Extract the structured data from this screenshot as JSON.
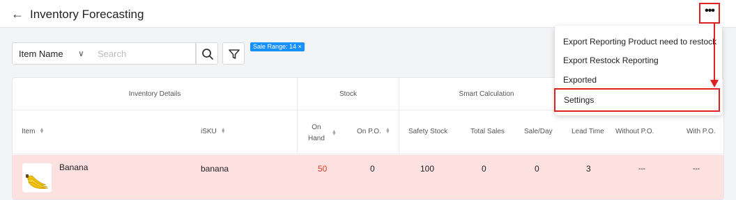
{
  "header": {
    "title": "Inventory Forecasting",
    "back_icon": "arrow-left-icon",
    "more_icon": "ellipsis-icon"
  },
  "filters": {
    "field_select": "Item Name",
    "search_placeholder": "Search",
    "chip_label": "Sale Range: 14 ×"
  },
  "table": {
    "groups": [
      "Inventory Details",
      "Stock",
      "Smart Calculation"
    ],
    "columns": {
      "item": "Item",
      "isku": "iSKU",
      "on_hand_1": "On",
      "on_hand_2": "Hand",
      "on_po": "On P.O.",
      "safety_stock": "Safety Stock",
      "total_sales": "Total Sales",
      "sale_day": "Sale/Day",
      "lead_time": "Lead Time",
      "without_po": "Without P.O.",
      "with_po": "With P.O."
    },
    "rows": [
      {
        "item": "Banana",
        "isku": "banana",
        "on_hand": "50",
        "on_po": "0",
        "safety_stock": "100",
        "total_sales": "0",
        "sale_day": "0",
        "lead_time": "3",
        "without_po": "---",
        "with_po": "---"
      }
    ],
    "on_hand_color": "#e03a1e",
    "row_bg": "#fde0e0"
  },
  "menu": {
    "items": [
      "Export Reporting Product need to restock",
      "Export Restock Reporting",
      "Exported",
      "Settings"
    ]
  },
  "accent": "#1890ff",
  "highlight": "#e02020"
}
